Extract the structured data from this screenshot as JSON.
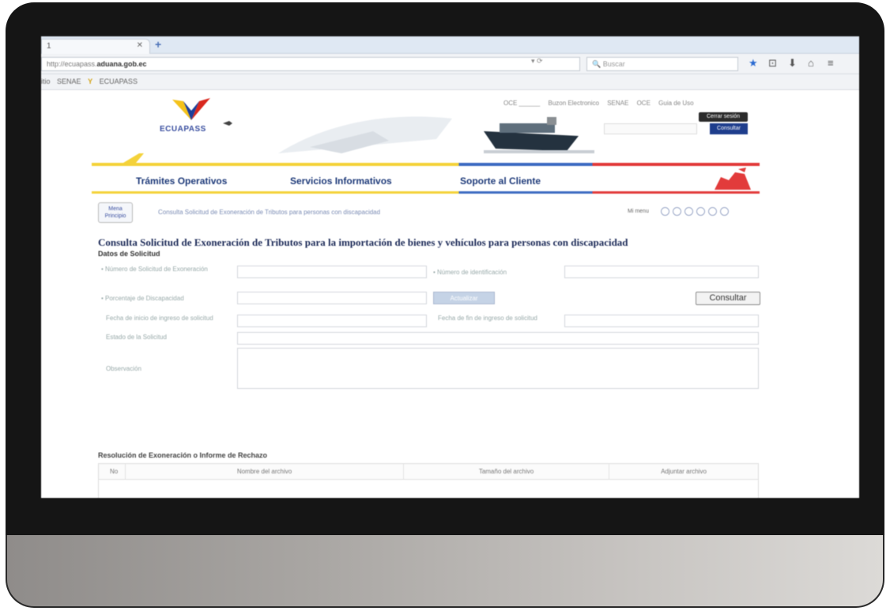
{
  "browser": {
    "tab_title": "1",
    "url_prefix": "http://ecuapass.",
    "url_domain": "aduana.gob.ec",
    "search_placeholder": "Buscar",
    "bookmarks": [
      "itio",
      "SENAE",
      "ECUAPASS"
    ]
  },
  "header": {
    "logo_text": "ECUAPASS",
    "top_links": [
      "OCE ______",
      "Buzon Electronico",
      "SENAE",
      "OCE",
      "Guia de Uso"
    ],
    "cerrar_label": "Cerrar sesión",
    "consultar_small": "Consultar"
  },
  "menu": [
    "Trámites Operativos",
    "Servicios Informativos",
    "Soporte al Cliente"
  ],
  "breadcrumb": {
    "home": "Mena Principio",
    "path": "Consulta Solicitud de Exoneración de Tributos para personas con discapacidad",
    "steps_label": "Mi menu"
  },
  "form": {
    "title": "Consulta Solicitud de Exoneración de Tributos para la importación de bienes y vehículos para personas con discapacidad",
    "section_title": "Datos de Solicitud",
    "numero_label": "• Número de Solicitud de Exoneración",
    "identificacion_label": "• Número de identificación",
    "porcentaje_label": "• Porcentaje de Discapacidad",
    "actualizar_label": "Actualizar",
    "consultar_label": "Consultar",
    "fecha_inicio_label": "Fecha de inicio de ingreso de solicitud",
    "fecha_fin_label": "Fecha de fin de ingreso de solicitud",
    "estado_label": "Estado de la Solicitud",
    "observacion_label": "Observación"
  },
  "attachments": {
    "title": "Resolución de Exoneración o Informe de Rechazo",
    "columns": [
      "No",
      "Nombre del archivo",
      "Tamaño del archivo",
      "Adjuntar archivo"
    ]
  },
  "colors": {
    "accent_blue": "#1f3b7a",
    "yellow": "#f4d23a",
    "red": "#e23b3b"
  }
}
